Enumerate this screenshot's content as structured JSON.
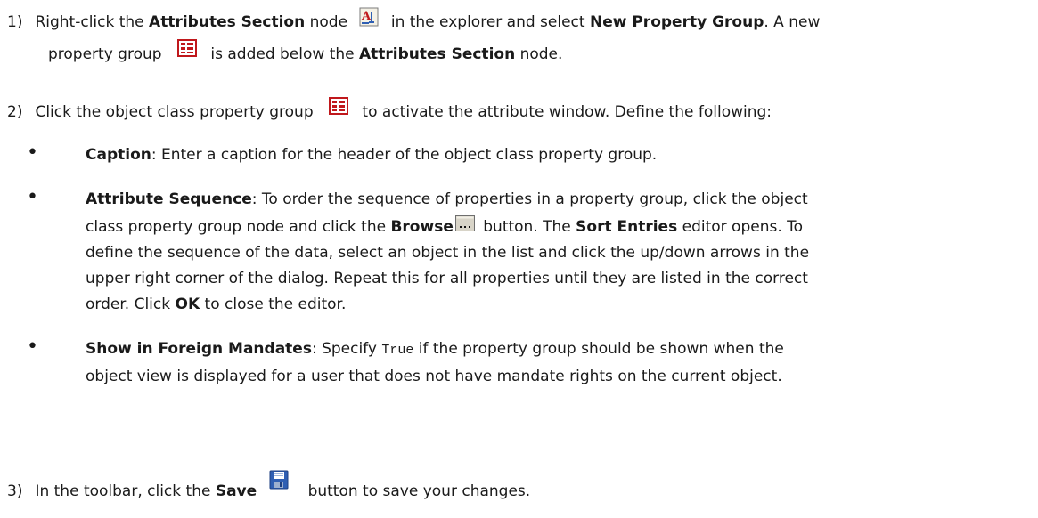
{
  "steps": [
    {
      "num": "1)",
      "l1_a": "Right-click the ",
      "l1_b": "Attributes Section",
      "l1_c": " node ",
      "l1_d": " in the explorer and select ",
      "l1_e": "New Property Group",
      "l1_f": ". A new",
      "l2_a": "property group ",
      "l2_b": " is added below the ",
      "l2_c": "Attributes Section",
      "l2_d": " node."
    },
    {
      "num": "2)",
      "l1_a": "Click the object class property group ",
      "l1_b": " to activate the attribute window. Define the following:"
    },
    {
      "num": "3)",
      "l1_a": "In the toolbar, click the ",
      "l1_b": "Save",
      "l1_c": " button to save your changes."
    }
  ],
  "bullets": [
    {
      "marker": "•",
      "title": "Caption",
      "lines": [
        ": Enter a caption for the header of the object class property group."
      ]
    },
    {
      "marker": "•",
      "title": "Attribute Sequence",
      "l1": ": To order the sequence of properties in a property group, click the object",
      "l2_a": "class property group node and click the ",
      "l2_b": "Browse",
      "l2_c": " button. The ",
      "l2_d": "Sort Entries",
      "l2_e": " editor opens. To",
      "l3": "define the sequence of the data, select an object in the list and click the up/down arrows in the",
      "l4": "upper right corner of the dialog. Repeat this for all properties until they are listed in the correct",
      "l5_a": "order. Click ",
      "l5_b": "OK",
      "l5_c": " to close the editor."
    },
    {
      "marker": "•",
      "title": "Show in Foreign Mandates",
      "l1_a": ": Specify ",
      "l1_code": "True",
      "l1_b": " if the property group should be shown when the",
      "l2": "object view is displayed for a user that does not have mandate rights on the current object."
    }
  ],
  "icons": {
    "attributes_section": "attributes-section-icon",
    "property_group": "property-group-icon",
    "browse": "browse-icon",
    "save": "save-icon"
  },
  "colors": {
    "text": "#1a1a1a",
    "icon_red": "#c0181c",
    "icon_blue": "#2f5fb3"
  }
}
